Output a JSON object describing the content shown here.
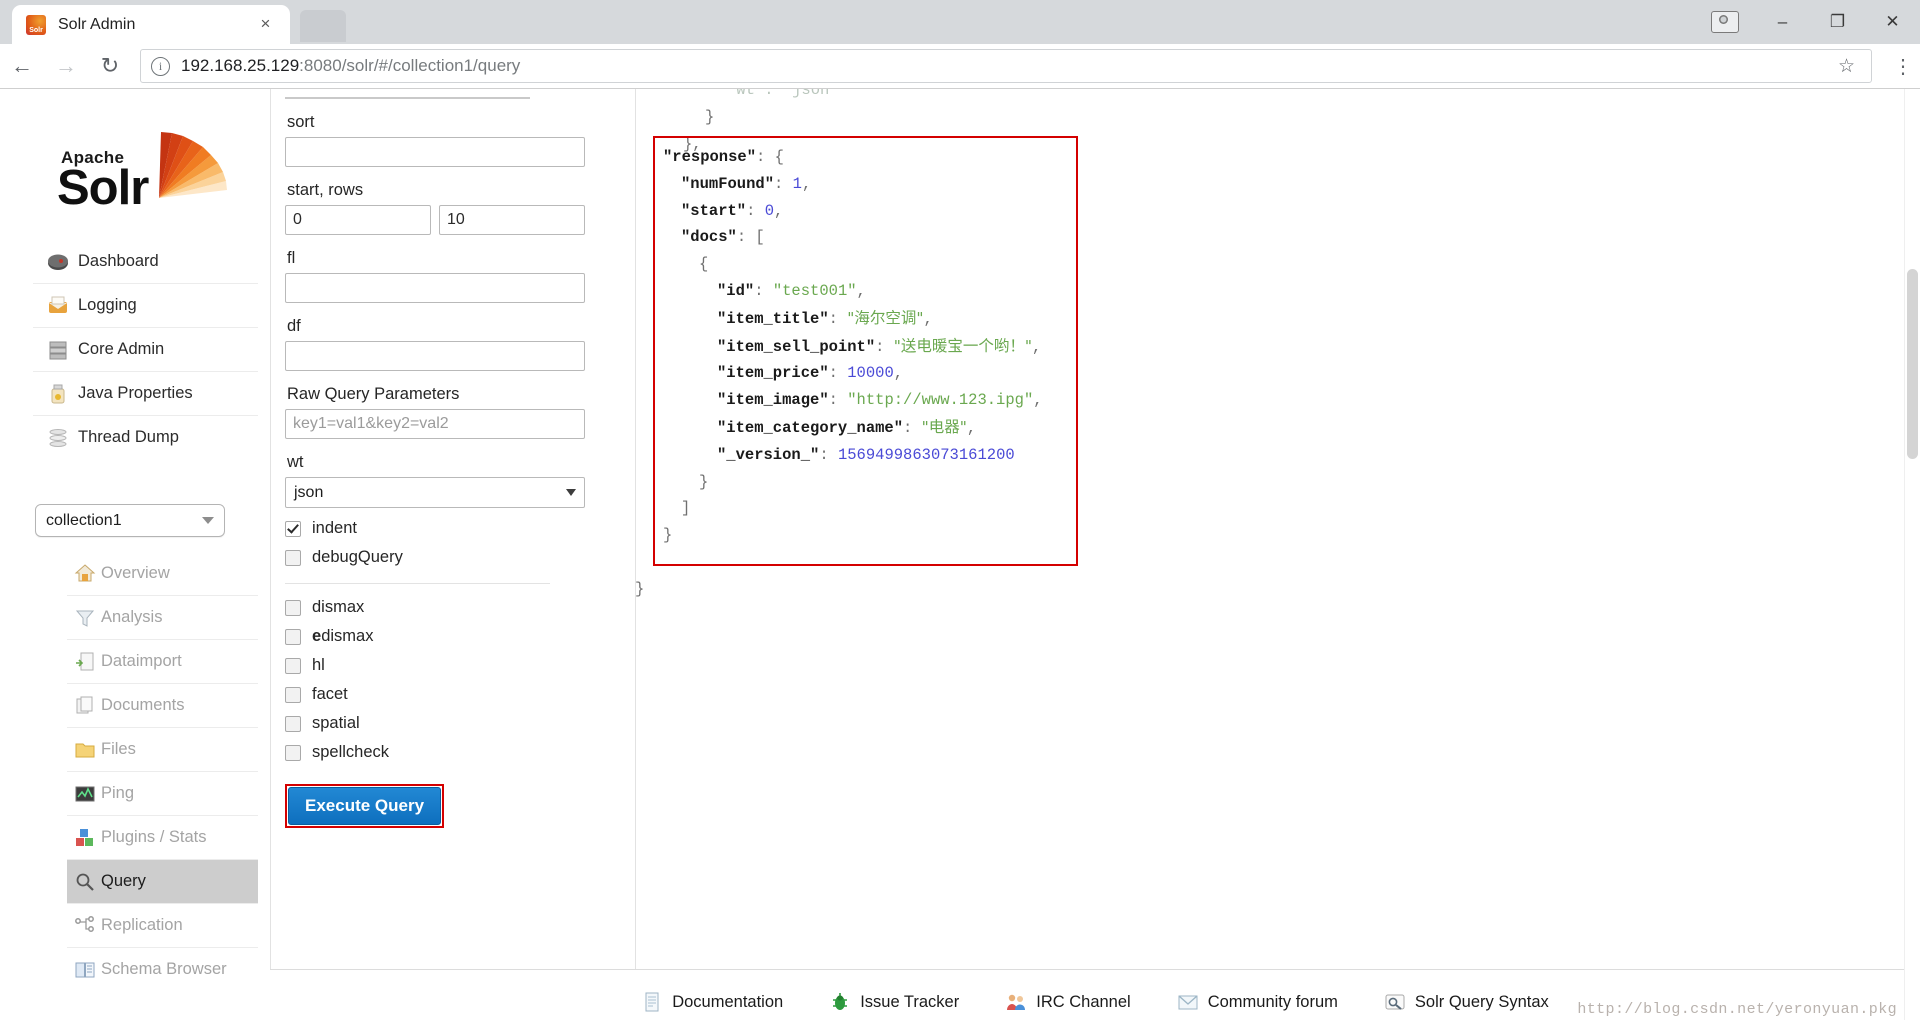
{
  "browser": {
    "tab": {
      "title": "Solr Admin",
      "favicon": "solr-favicon",
      "close": "×"
    },
    "window": {
      "minimize": "–",
      "maximize": "❐",
      "close": "✕",
      "user_icon": "user-avatar-icon"
    },
    "toolbar": {
      "back": "←",
      "forward": "→",
      "reload": "↻",
      "info_icon": "ⓘ",
      "url_host": "192.168.25.129",
      "url_path": ":8080/solr/#/collection1/query",
      "star": "☆",
      "menu": "⋮"
    }
  },
  "sidebar": {
    "logo": {
      "top": "Apache",
      "bottom": "Solr"
    },
    "items": [
      {
        "label": "Dashboard",
        "icon": "dashboard-icon"
      },
      {
        "label": "Logging",
        "icon": "logging-icon"
      },
      {
        "label": "Core Admin",
        "icon": "core-admin-icon"
      },
      {
        "label": "Java Properties",
        "icon": "java-properties-icon"
      },
      {
        "label": "Thread Dump",
        "icon": "thread-dump-icon"
      }
    ],
    "core_select": {
      "value": "collection1",
      "caret": "▼"
    },
    "core_items": [
      {
        "label": "Overview",
        "icon": "house-icon",
        "active": false
      },
      {
        "label": "Analysis",
        "icon": "funnel-icon",
        "active": false
      },
      {
        "label": "Dataimport",
        "icon": "dataimport-icon",
        "active": false
      },
      {
        "label": "Documents",
        "icon": "documents-icon",
        "active": false
      },
      {
        "label": "Files",
        "icon": "folder-icon",
        "active": false
      },
      {
        "label": "Ping",
        "icon": "ping-icon",
        "active": false
      },
      {
        "label": "Plugins / Stats",
        "icon": "plugins-icon",
        "active": false
      },
      {
        "label": "Query",
        "icon": "magnifier-icon",
        "active": true
      },
      {
        "label": "Replication",
        "icon": "replication-icon",
        "active": false
      },
      {
        "label": "Schema Browser",
        "icon": "book-icon",
        "active": false
      }
    ]
  },
  "query_form": {
    "fields": [
      {
        "name": "sort",
        "label": "sort",
        "value": "",
        "placeholder": ""
      },
      {
        "name": "fl",
        "label": "fl",
        "value": "",
        "placeholder": ""
      },
      {
        "name": "df",
        "label": "df",
        "value": "",
        "placeholder": ""
      }
    ],
    "start_rows": {
      "label": "start, rows",
      "start": "0",
      "rows": "10"
    },
    "raw_query": {
      "label": "Raw Query Parameters",
      "value": "",
      "placeholder": "key1=val1&key2=val2"
    },
    "wt": {
      "label": "wt",
      "value": "json",
      "caret": "▼"
    },
    "checkboxes_primary": [
      {
        "label": "indent",
        "checked": true
      },
      {
        "label": "debugQuery",
        "checked": false
      }
    ],
    "checkboxes_secondary": [
      {
        "label": "dismax",
        "checked": false,
        "bold_prefix": ""
      },
      {
        "label": "dismax",
        "checked": false,
        "bold_prefix": "e"
      },
      {
        "label": "hl",
        "checked": false,
        "bold_prefix": ""
      },
      {
        "label": "facet",
        "checked": false,
        "bold_prefix": ""
      },
      {
        "label": "spatial",
        "checked": false,
        "bold_prefix": ""
      },
      {
        "label": "spellcheck",
        "checked": false,
        "bold_prefix": ""
      }
    ],
    "execute_button": "Execute Query"
  },
  "results": {
    "top_lines": [
      {
        "indent": 4,
        "tokens": [
          {
            "t": "\"wt\"",
            "c": "dim"
          },
          {
            "t": ": ",
            "c": "dim"
          },
          {
            "t": "\"json\"",
            "c": "dim"
          }
        ]
      },
      {
        "indent": 2,
        "tokens": [
          {
            "t": "}",
            "c": "pun"
          }
        ]
      },
      {
        "indent": 0,
        "tokens": [
          {
            "t": "},",
            "c": "pun"
          }
        ]
      }
    ],
    "highlight_lines": [
      {
        "indent": 0,
        "tokens": [
          {
            "t": "\"response\"",
            "c": "key"
          },
          {
            "t": ": {",
            "c": "pun"
          }
        ]
      },
      {
        "indent": 1,
        "tokens": [
          {
            "t": "\"numFound\"",
            "c": "key"
          },
          {
            "t": ": ",
            "c": "pun"
          },
          {
            "t": "1",
            "c": "num"
          },
          {
            "t": ",",
            "c": "pun"
          }
        ]
      },
      {
        "indent": 1,
        "tokens": [
          {
            "t": "\"start\"",
            "c": "key"
          },
          {
            "t": ": ",
            "c": "pun"
          },
          {
            "t": "0",
            "c": "num"
          },
          {
            "t": ",",
            "c": "pun"
          }
        ]
      },
      {
        "indent": 1,
        "tokens": [
          {
            "t": "\"docs\"",
            "c": "key"
          },
          {
            "t": ": [",
            "c": "pun"
          }
        ]
      },
      {
        "indent": 2,
        "tokens": [
          {
            "t": "{",
            "c": "pun"
          }
        ]
      },
      {
        "indent": 3,
        "tokens": [
          {
            "t": "\"id\"",
            "c": "key"
          },
          {
            "t": ": ",
            "c": "pun"
          },
          {
            "t": "\"test001\"",
            "c": "str"
          },
          {
            "t": ",",
            "c": "pun"
          }
        ]
      },
      {
        "indent": 3,
        "tokens": [
          {
            "t": "\"item_title\"",
            "c": "key"
          },
          {
            "t": ": ",
            "c": "pun"
          },
          {
            "t": "\"海尔空调\"",
            "c": "cjk"
          },
          {
            "t": ",",
            "c": "pun"
          }
        ]
      },
      {
        "indent": 3,
        "tokens": [
          {
            "t": "\"item_sell_point\"",
            "c": "key"
          },
          {
            "t": ": ",
            "c": "pun"
          },
          {
            "t": "\"送电暖宝一个哟！\"",
            "c": "cjk"
          },
          {
            "t": ",",
            "c": "pun"
          }
        ]
      },
      {
        "indent": 3,
        "tokens": [
          {
            "t": "\"item_price\"",
            "c": "key"
          },
          {
            "t": ": ",
            "c": "pun"
          },
          {
            "t": "10000",
            "c": "num"
          },
          {
            "t": ",",
            "c": "pun"
          }
        ]
      },
      {
        "indent": 3,
        "tokens": [
          {
            "t": "\"item_image\"",
            "c": "key"
          },
          {
            "t": ": ",
            "c": "pun"
          },
          {
            "t": "\"http://www.123.ipg\"",
            "c": "str"
          },
          {
            "t": ",",
            "c": "pun"
          }
        ]
      },
      {
        "indent": 3,
        "tokens": [
          {
            "t": "\"item_category_name\"",
            "c": "key"
          },
          {
            "t": ": ",
            "c": "pun"
          },
          {
            "t": "\"电器\"",
            "c": "cjk"
          },
          {
            "t": ",",
            "c": "pun"
          }
        ]
      },
      {
        "indent": 3,
        "tokens": [
          {
            "t": "\"_version_\"",
            "c": "key"
          },
          {
            "t": ": ",
            "c": "pun"
          },
          {
            "t": "1569499863073161200",
            "c": "num"
          }
        ]
      },
      {
        "indent": 2,
        "tokens": [
          {
            "t": "}",
            "c": "pun"
          }
        ]
      },
      {
        "indent": 1,
        "tokens": [
          {
            "t": "]",
            "c": "pun"
          }
        ]
      },
      {
        "indent": 0,
        "tokens": [
          {
            "t": "}",
            "c": "pun"
          }
        ]
      }
    ],
    "tail_lines": [
      {
        "indent": 0,
        "tokens": [
          {
            "t": "}",
            "c": "pun"
          }
        ]
      }
    ],
    "highlight_color": "#d40000"
  },
  "footer": {
    "links": [
      {
        "label": "Documentation",
        "icon": "document-icon"
      },
      {
        "label": "Issue Tracker",
        "icon": "bug-icon"
      },
      {
        "label": "IRC Channel",
        "icon": "people-icon"
      },
      {
        "label": "Community forum",
        "icon": "envelope-icon"
      },
      {
        "label": "Solr Query Syntax",
        "icon": "query-syntax-icon"
      }
    ]
  },
  "watermark": "http://blog.csdn.net/yeronyuan.pkg"
}
